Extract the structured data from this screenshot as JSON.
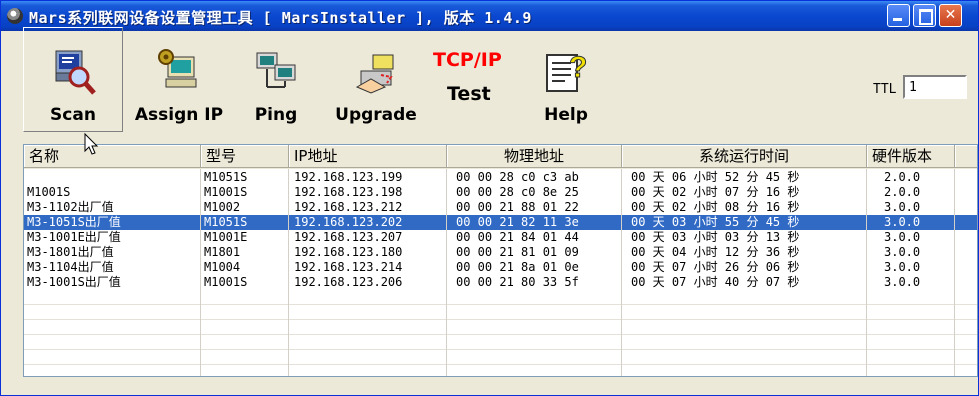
{
  "window": {
    "title": "Mars系列联网设备设置管理工具 [ MarsInstaller ], 版本 1.4.9"
  },
  "toolbar": {
    "scan_label": "Scan",
    "assign_ip_label": "Assign IP",
    "ping_label": "Ping",
    "upgrade_label": "Upgrade",
    "tcpip_label": "TCP/IP",
    "test_label": "Test",
    "help_label": "Help",
    "ttl_label": "TTL",
    "ttl_value": "1"
  },
  "table": {
    "headers": [
      "名称",
      "型号",
      "IP地址",
      "物理地址",
      "系统运行时间",
      "硬件版本"
    ],
    "rows": [
      [
        "",
        "M1051S",
        "192.168.123.199",
        "00 00 28 c0 c3 ab",
        "00 天 06 小时 52 分 45 秒",
        "2.0.0"
      ],
      [
        "M1001S",
        "M1001S",
        "192.168.123.198",
        "00 00 28 c0 8e 25",
        "00 天 02 小时 07 分 16 秒",
        "2.0.0"
      ],
      [
        "M3-1102出厂值",
        "M1002",
        "192.168.123.212",
        "00 00 21 88 01 22",
        "00 天 02 小时 08 分 16 秒",
        "3.0.0"
      ],
      [
        "M3-1051S出厂值",
        "M1051S",
        "192.168.123.202",
        "00 00 21 82 11 3e",
        "00 天 03 小时 55 分 45 秒",
        "3.0.0"
      ],
      [
        "M3-1001E出厂值",
        "M1001E",
        "192.168.123.207",
        "00 00 21 84 01 44",
        "00 天 03 小时 03 分 13 秒",
        "3.0.0"
      ],
      [
        "M3-1801出厂值",
        "M1801",
        "192.168.123.180",
        "00 00 21 81 01 09",
        "00 天 04 小时 12 分 36 秒",
        "3.0.0"
      ],
      [
        "M3-1104出厂值",
        "M1004",
        "192.168.123.214",
        "00 00 21 8a 01 0e",
        "00 天 07 小时 26 分 06 秒",
        "3.0.0"
      ],
      [
        "M3-1001S出厂值",
        "M1001S",
        "192.168.123.206",
        "00 00 21 80 33 5f",
        "00 天 07 小时 40 分 07 秒",
        "3.0.0"
      ]
    ],
    "selected_row": 3
  },
  "icons": {
    "title": "app-icon",
    "scan": "magnifier-computer-icon",
    "assign_ip": "computer-gear-icon",
    "ping": "network-computers-icon",
    "upgrade": "upgrade-hand-icon",
    "help": "help-document-icon"
  },
  "colors": {
    "selection": "#316ac5",
    "tcpip": "#ff0000",
    "titlebar": "#0a48d0"
  }
}
